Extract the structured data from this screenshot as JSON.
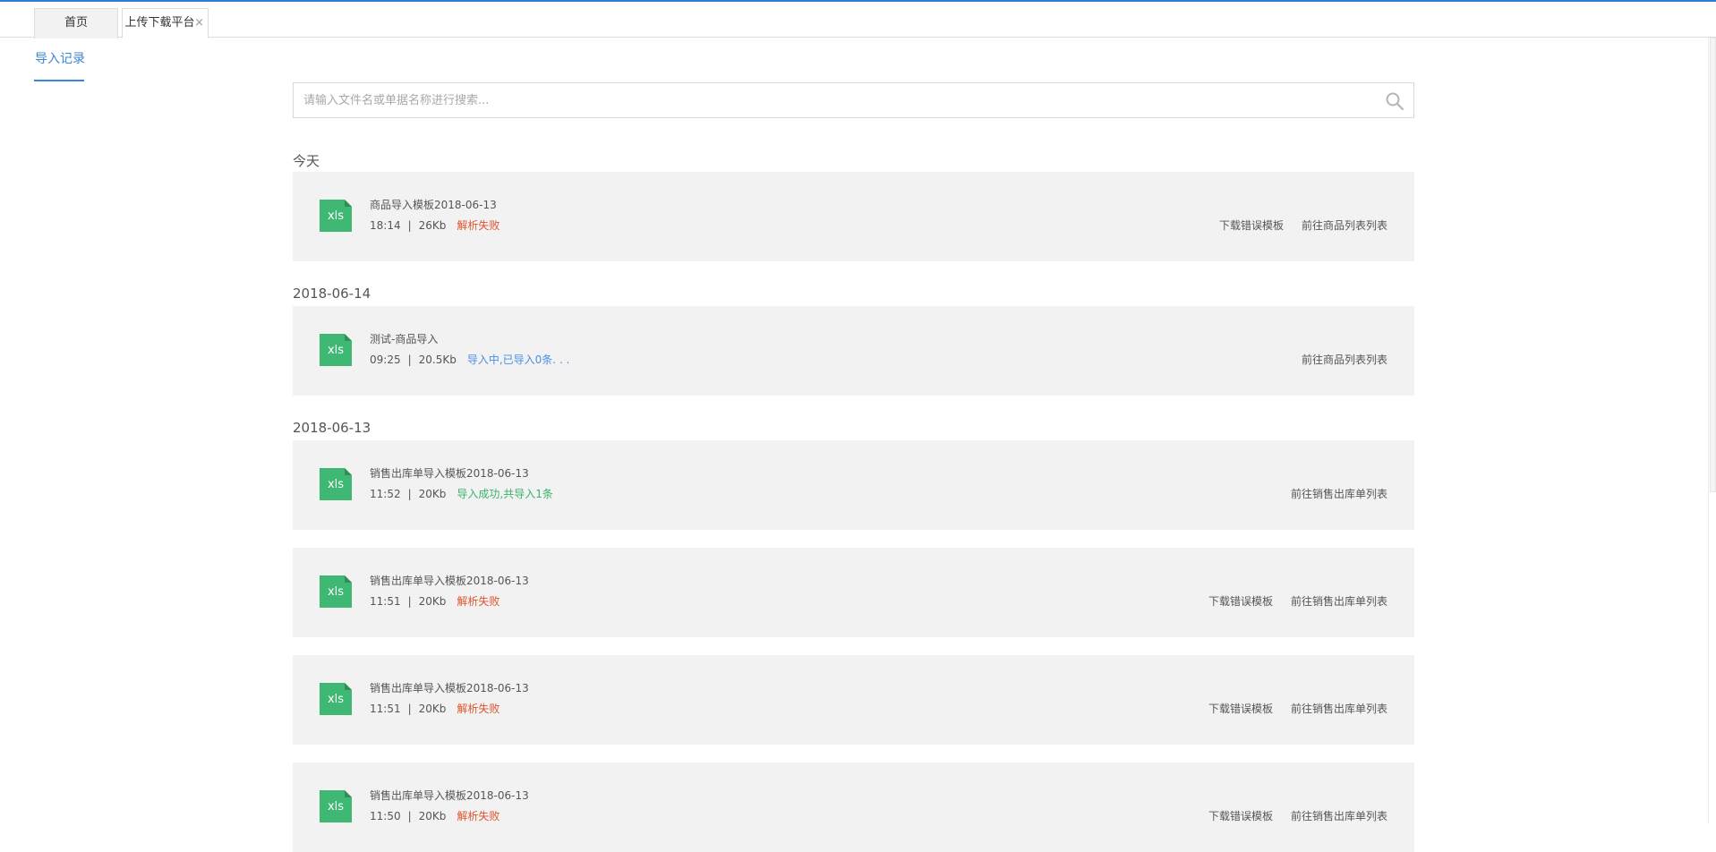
{
  "tabs": [
    {
      "label": "首页"
    },
    {
      "label": "上传下载平台",
      "close": "×"
    }
  ],
  "subnav": {
    "label": "导入记录"
  },
  "search": {
    "placeholder": "请输入文件名或单据名称进行搜索..."
  },
  "groups": [
    {
      "date": "今天",
      "records": [
        {
          "icon": "xls",
          "name": "商品导入模板2018-06-13",
          "time": "18:14",
          "size": "26Kb",
          "status": "解析失败",
          "status_kind": "fail",
          "actions": [
            "下载错误模板",
            "前往商品列表列表"
          ]
        }
      ]
    },
    {
      "date": "2018-06-14",
      "records": [
        {
          "icon": "xls",
          "name": "测试-商品导入",
          "time": "09:25",
          "size": "20.5Kb",
          "status": "导入中,已导入0条. . .",
          "status_kind": "progress",
          "actions": [
            "前往商品列表列表"
          ]
        }
      ]
    },
    {
      "date": "2018-06-13",
      "records": [
        {
          "icon": "xls",
          "name": "销售出库单导入模板2018-06-13",
          "time": "11:52",
          "size": "20Kb",
          "status": "导入成功,共导入1条",
          "status_kind": "success",
          "actions": [
            "前往销售出库单列表"
          ]
        },
        {
          "icon": "xls",
          "name": "销售出库单导入模板2018-06-13",
          "time": "11:51",
          "size": "20Kb",
          "status": "解析失败",
          "status_kind": "fail",
          "actions": [
            "下载错误模板",
            "前往销售出库单列表"
          ]
        },
        {
          "icon": "xls",
          "name": "销售出库单导入模板2018-06-13",
          "time": "11:51",
          "size": "20Kb",
          "status": "解析失败",
          "status_kind": "fail",
          "actions": [
            "下载错误模板",
            "前往销售出库单列表"
          ]
        },
        {
          "icon": "xls",
          "name": "销售出库单导入模板2018-06-13",
          "time": "11:50",
          "size": "20Kb",
          "status": "解析失败",
          "status_kind": "fail",
          "actions": [
            "下载错误模板",
            "前往销售出库单列表"
          ]
        }
      ]
    }
  ],
  "colors": {
    "accent": "#3c86d6",
    "file_icon": "#3fb874",
    "status_fail": "#e0532c",
    "status_progress": "#4a8fe3",
    "status_success": "#3ab36c"
  }
}
